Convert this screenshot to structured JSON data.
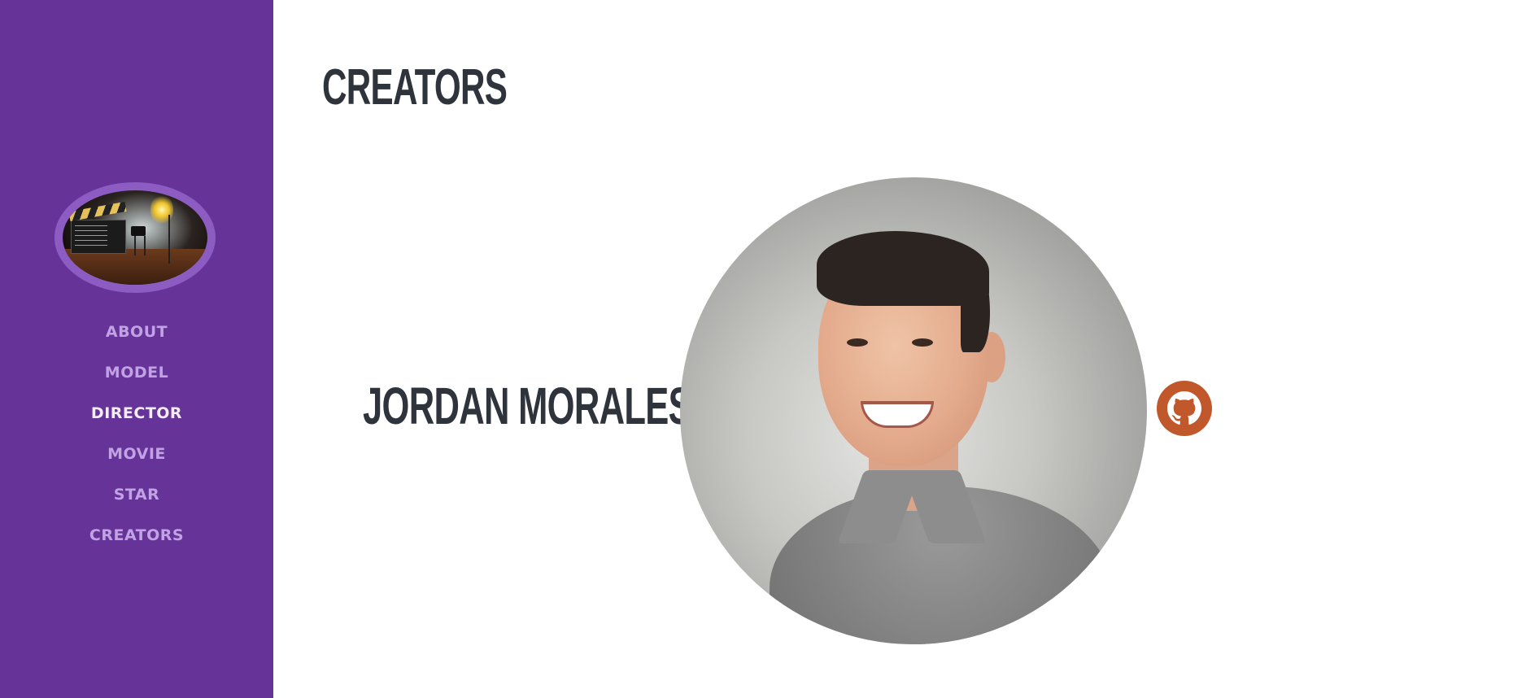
{
  "sidebar": {
    "logo_alt": "film clapperboard and camera",
    "nav": [
      {
        "label": "ABOUT",
        "active": false
      },
      {
        "label": "MODEL",
        "active": false
      },
      {
        "label": "DIRECTOR",
        "active": true
      },
      {
        "label": "MOVIE",
        "active": false
      },
      {
        "label": "STAR",
        "active": false
      },
      {
        "label": "CREATORS",
        "active": false
      }
    ]
  },
  "main": {
    "title": "CREATORS",
    "creators": [
      {
        "name": "JORDAN MORALES",
        "photo": "headshot of smiling man in grey shirt",
        "link_icon": "github-icon"
      }
    ]
  },
  "colors": {
    "sidebar_bg": "#663399",
    "nav_text": "#c1a3e3",
    "nav_active": "#f3ecfb",
    "heading": "#2f343c",
    "github": "#c0582c"
  }
}
